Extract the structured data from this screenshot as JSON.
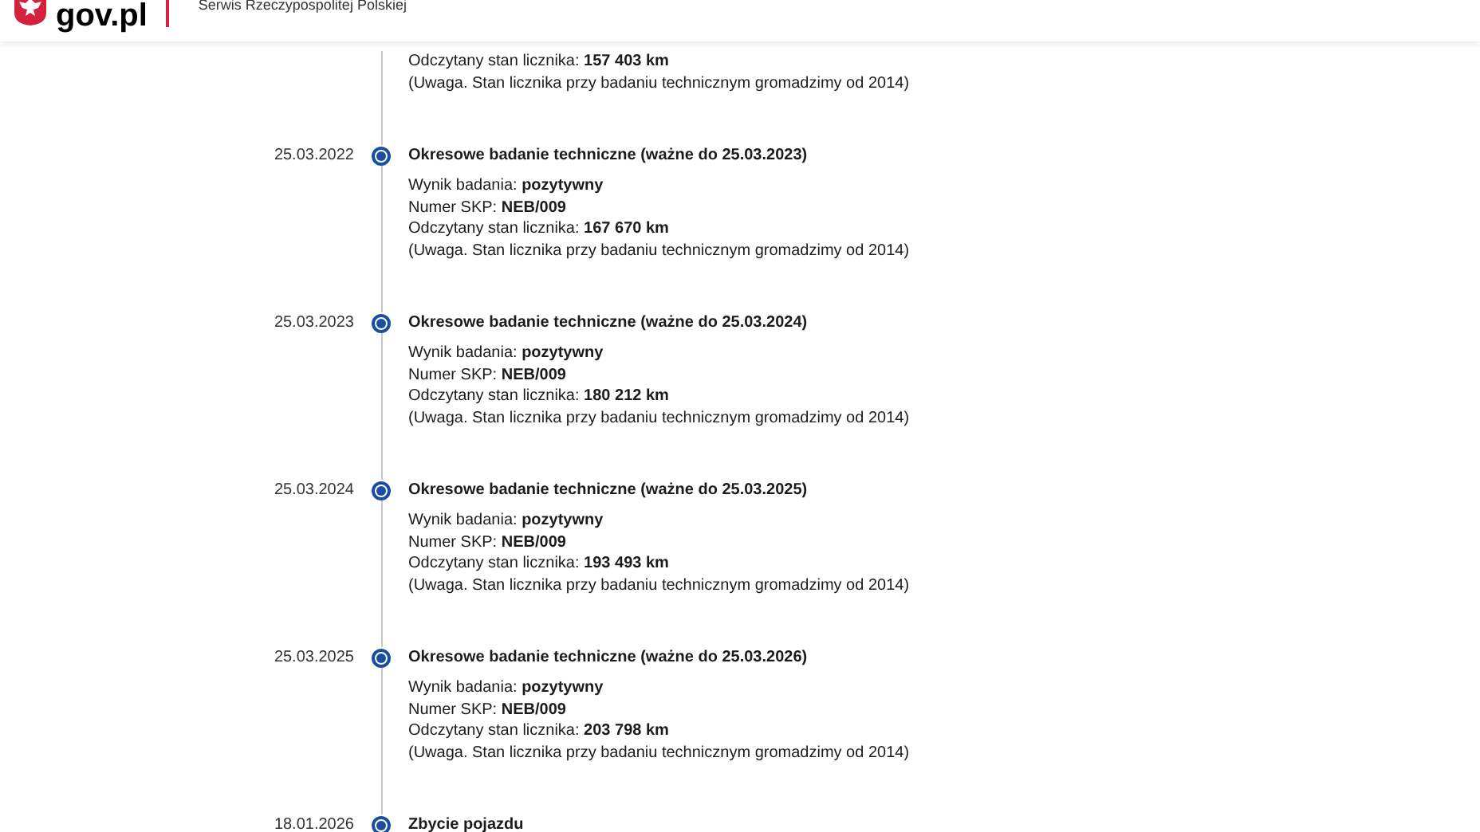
{
  "header": {
    "logo_text": "gov.pl",
    "subtitle": "Serwis Rzeczypospolitej Polskiej"
  },
  "timeline": [
    {
      "lines": [
        "Odczytany stan licznika: **157 403 km**"
      ],
      "note": "(Uwaga. Stan licznika przy badaniu technicznym gromadzimy od 2014)"
    },
    {
      "date": "25.03.2022",
      "title": "Okresowe badanie techniczne (ważne do 25.03.2023)",
      "lines": [
        "Wynik badania: **pozytywny**",
        "Numer SKP: **NEB/009**",
        "Odczytany stan licznika: **167 670 km**"
      ],
      "note": "(Uwaga. Stan licznika przy badaniu technicznym gromadzimy od 2014)"
    },
    {
      "date": "25.03.2023",
      "title": "Okresowe badanie techniczne (ważne do 25.03.2024)",
      "lines": [
        "Wynik badania: **pozytywny**",
        "Numer SKP: **NEB/009**",
        "Odczytany stan licznika: **180 212 km**"
      ],
      "note": "(Uwaga. Stan licznika przy badaniu technicznym gromadzimy od 2014)"
    },
    {
      "date": "25.03.2024",
      "title": "Okresowe badanie techniczne (ważne do 25.03.2025)",
      "lines": [
        "Wynik badania: **pozytywny**",
        "Numer SKP: **NEB/009**",
        "Odczytany stan licznika: **193 493 km**"
      ],
      "note": "(Uwaga. Stan licznika przy badaniu technicznym gromadzimy od 2014)"
    },
    {
      "date": "25.03.2025",
      "title": "Okresowe badanie techniczne (ważne do 25.03.2026)",
      "lines": [
        "Wynik badania: **pozytywny**",
        "Numer SKP: **NEB/009**",
        "Odczytany stan licznika: **203 798 km**"
      ],
      "note": "(Uwaga. Stan licznika przy badaniu technicznym gromadzimy od 2014)"
    },
    {
      "date": "18.01.2026",
      "title": "Zbycie pojazdu"
    }
  ]
}
